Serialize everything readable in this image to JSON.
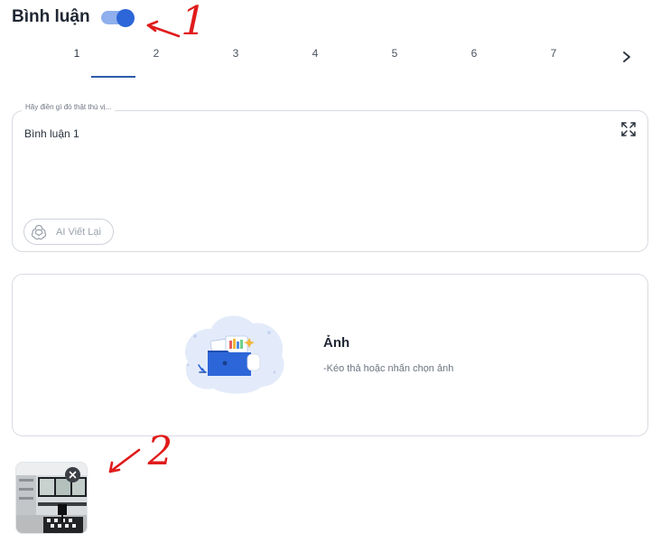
{
  "header": {
    "title": "Bình luận",
    "toggle_on": true
  },
  "tabs": [
    "1",
    "2",
    "3",
    "4",
    "5",
    "6",
    "7"
  ],
  "active_tab": "1",
  "comment": {
    "placeholder": "Hãy điền gì đó thật thú vị...",
    "value": "Bình luận 1",
    "ai_button_label": "AI Viết Lại"
  },
  "upload": {
    "title": "Ảnh",
    "hint": "-Kéo thả hoặc nhấn chọn ảnh"
  },
  "annotations": [
    "1",
    "2"
  ],
  "colors": {
    "accent": "#2d66d8",
    "tab_underline": "#2c5aa8",
    "annotation_red": "#e01b1b"
  }
}
